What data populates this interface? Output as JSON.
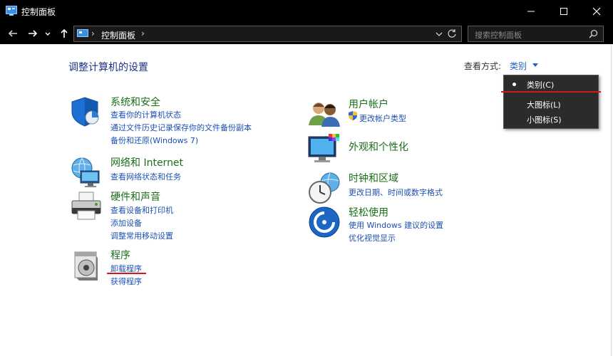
{
  "window": {
    "title": "控制面板",
    "controls": [
      "minimize-icon",
      "maximize-icon",
      "close-icon"
    ]
  },
  "address_bar": {
    "breadcrumb": [
      "控制面板"
    ],
    "search_placeholder": "搜索控制面板"
  },
  "header": {
    "title": "调整计算机的设置",
    "view_by_label": "查看方式:",
    "view_by_value": "类别"
  },
  "view_menu": {
    "items": [
      "类别(C)",
      "大图标(L)",
      "小图标(S)"
    ],
    "selected_index": 0
  },
  "categories_left": [
    {
      "title": "系统和安全",
      "icon": "shield-icon",
      "links": [
        "查看你的计算机状态",
        "通过文件历史记录保存你的文件备份副本",
        "备份和还原(Windows 7)"
      ]
    },
    {
      "title": "网络和 Internet",
      "icon": "network-globe-icon",
      "links": [
        "查看网络状态和任务"
      ]
    },
    {
      "title": "硬件和声音",
      "icon": "printer-icon",
      "links": [
        "查看设备和打印机",
        "添加设备",
        "调整常用移动设置"
      ]
    },
    {
      "title": "程序",
      "icon": "programs-disc-icon",
      "links": [
        "卸载程序",
        "获得程序"
      ]
    }
  ],
  "categories_right": [
    {
      "title": "用户帐户",
      "icon": "users-icon",
      "links": [
        "更改帐户类型"
      ]
    },
    {
      "title": "外观和个性化",
      "icon": "monitor-palette-icon",
      "links": []
    },
    {
      "title": "时钟和区域",
      "icon": "clock-globe-icon",
      "links": [
        "更改日期、时间或数字格式"
      ]
    },
    {
      "title": "轻松使用",
      "icon": "ease-of-access-icon",
      "links": [
        "使用 Windows 建议的设置",
        "优化视觉显示"
      ]
    }
  ],
  "colors": {
    "title_bar": "#000000",
    "heading_green": "#1a6e1a",
    "link_blue": "#1c50b5",
    "annotation_red": "#d01a1a"
  }
}
